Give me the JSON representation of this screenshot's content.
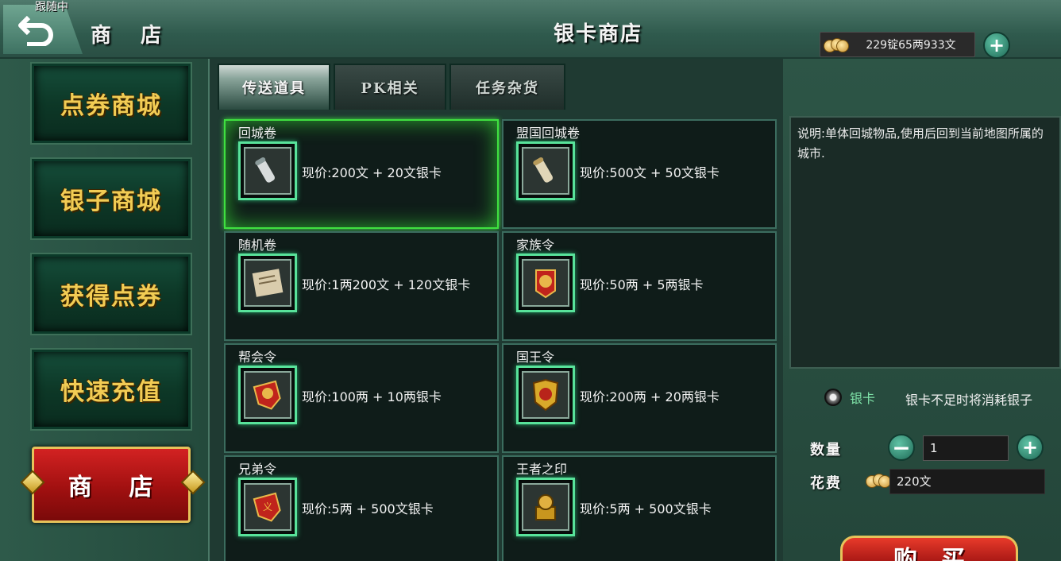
{
  "header": {
    "follow_status": "跟随中",
    "section_title": "商  店",
    "shop_title": "银卡商店",
    "currency_text": "229锭65两933文",
    "add_currency_label": "+"
  },
  "sidebar": {
    "items": [
      {
        "label": "点券商城"
      },
      {
        "label": "银子商城"
      },
      {
        "label": "获得点券"
      },
      {
        "label": "快速充值"
      },
      {
        "label": "商 店",
        "active": true
      }
    ]
  },
  "tabs": [
    {
      "label": "传送道具",
      "active": true
    },
    {
      "label": "PK相关",
      "active": false
    },
    {
      "label": "任务杂货",
      "active": false
    }
  ],
  "items": [
    {
      "name": "回城卷",
      "price": "现价:200文 + 20文银卡",
      "icon": "scroll-icon",
      "selected": true
    },
    {
      "name": "盟国回城卷",
      "price": "现价:500文 + 50文银卡",
      "icon": "scroll-icon",
      "selected": false
    },
    {
      "name": "随机卷",
      "price": "现价:1两200文 + 120文银卡",
      "icon": "parchment-icon",
      "selected": false
    },
    {
      "name": "家族令",
      "price": "现价:50两 + 5两银卡",
      "icon": "family-token-icon",
      "selected": false
    },
    {
      "name": "帮会令",
      "price": "现价:100两 + 10两银卡",
      "icon": "guild-token-icon",
      "selected": false
    },
    {
      "name": "国王令",
      "price": "现价:200两 + 20两银卡",
      "icon": "king-token-icon",
      "selected": false
    },
    {
      "name": "兄弟令",
      "price": "现价:5两 + 500文银卡",
      "icon": "brother-token-icon",
      "selected": false
    },
    {
      "name": "王者之印",
      "price": "现价:5两 + 500文银卡",
      "icon": "seal-icon",
      "selected": false
    }
  ],
  "detail": {
    "description": "说明:单体回城物品,使用后回到当前地图所属的城市.",
    "payment_option": "银卡",
    "payment_note": "银卡不足时将消耗银子",
    "quantity_label": "数量",
    "quantity_value": "1",
    "cost_label": "花费",
    "cost_value": "220文",
    "buy_label": "购买"
  },
  "colors": {
    "selected_border": "#3fe040",
    "nav_text": "#f2cc54",
    "active_nav": "#c01a1a"
  }
}
